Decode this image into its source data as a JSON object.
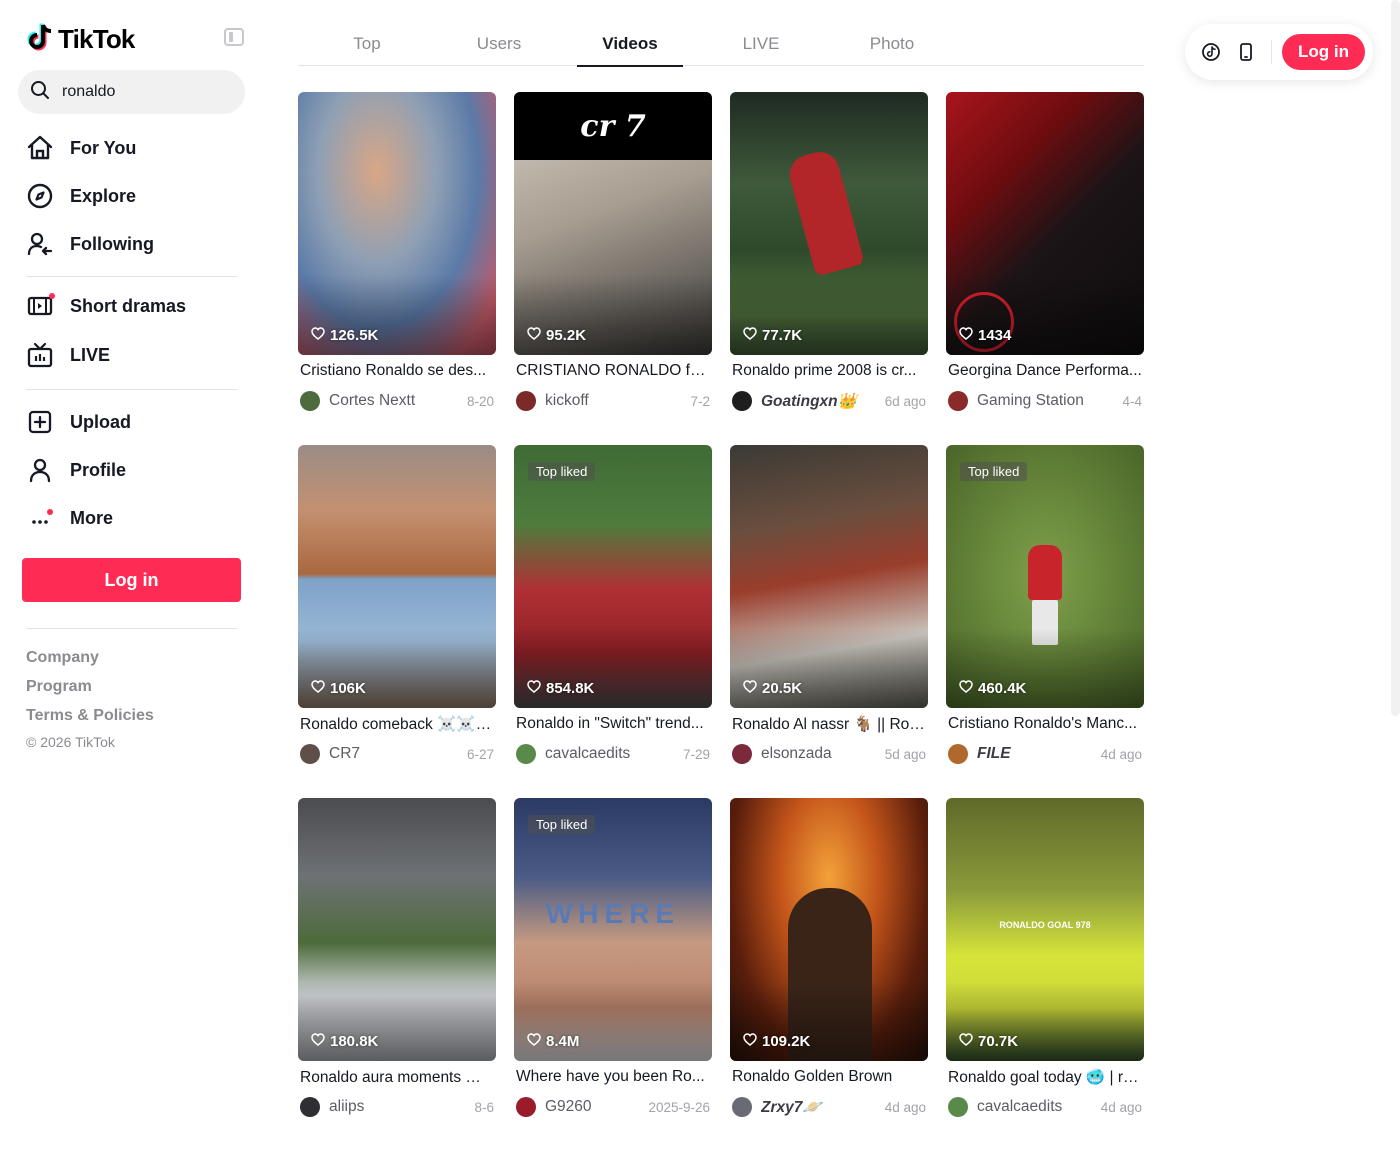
{
  "logo": {
    "text": "TikTok"
  },
  "search": {
    "value": "ronaldo"
  },
  "nav": [
    {
      "label": "For You",
      "icon": "home-icon"
    },
    {
      "label": "Explore",
      "icon": "compass-icon"
    },
    {
      "label": "Following",
      "icon": "following-icon"
    },
    {
      "label": "Short dramas",
      "icon": "film-icon"
    },
    {
      "label": "LIVE",
      "icon": "live-tv-icon"
    },
    {
      "label": "Upload",
      "icon": "upload-icon"
    },
    {
      "label": "Profile",
      "icon": "profile-icon"
    },
    {
      "label": "More",
      "icon": "more-icon"
    }
  ],
  "sidebar_login": "Log in",
  "footer": {
    "links": [
      "Company",
      "Program",
      "Terms & Policies"
    ],
    "copyright": "© 2026 TikTok"
  },
  "tabs": [
    {
      "label": "Top",
      "active": false
    },
    {
      "label": "Users",
      "active": false
    },
    {
      "label": "Videos",
      "active": true
    },
    {
      "label": "LIVE",
      "active": false
    },
    {
      "label": "Photo",
      "active": false
    }
  ],
  "topbar": {
    "login": "Log in"
  },
  "colors": {
    "accent": "#fe2c55",
    "text": "#161823",
    "muted": "#8a8b91"
  },
  "videos": [
    {
      "likes": "126.5K",
      "title": "Cristiano Ronaldo se des...",
      "author": "Cortes Nextt",
      "date": "8-20",
      "badge": ""
    },
    {
      "likes": "95.2K",
      "title": "CRISTIANO RONALDO for...",
      "author": "kickoff",
      "date": "7-2",
      "badge": "",
      "overlay": "cr 7"
    },
    {
      "likes": "77.7K",
      "title": "Ronaldo prime 2008 is cr...",
      "author": "Goatingxn👑",
      "date": "6d ago",
      "badge": ""
    },
    {
      "likes": "1434",
      "title": "Georgina Dance Performa...",
      "author": "Gaming Station",
      "date": "4-4",
      "badge": ""
    },
    {
      "likes": "106K",
      "title": "Ronaldo comeback ☠️☠️ |...",
      "author": "CR7",
      "date": "6-27",
      "badge": ""
    },
    {
      "likes": "854.8K",
      "title": "Ronaldo in \"Switch\" trend...",
      "author": "cavalcaedits",
      "date": "7-29",
      "badge": "Top liked"
    },
    {
      "likes": "20.5K",
      "title": "Ronaldo Al nassr 🐐 || Ron...",
      "author": "elsonzada",
      "date": "5d ago",
      "badge": ""
    },
    {
      "likes": "460.4K",
      "title": "Cristiano Ronaldo's Manc...",
      "author": "FILE",
      "date": "4d ago",
      "badge": "Top liked"
    },
    {
      "likes": "180.8K",
      "title": "Ronaldo aura moments ☠️...",
      "author": "aliips",
      "date": "8-6",
      "badge": ""
    },
    {
      "likes": "8.4M",
      "title": "Where have you been Ro...",
      "author": "G9260",
      "date": "2025-9-26",
      "badge": "Top liked",
      "overlay": "WHERE"
    },
    {
      "likes": "109.2K",
      "title": "Ronaldo Golden Brown",
      "author": "Zrxy7🪐",
      "date": "4d ago",
      "badge": ""
    },
    {
      "likes": "70.7K",
      "title": "Ronaldo goal today 🥶 | ro...",
      "author": "cavalcaedits",
      "date": "4d ago",
      "badge": "",
      "overlay": "RONALDO GOAL 978"
    }
  ]
}
